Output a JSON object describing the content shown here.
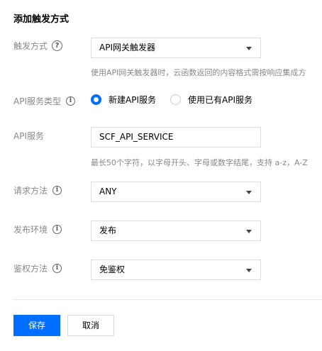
{
  "dialog": {
    "title": "添加触发方式"
  },
  "trigger": {
    "label": "触发方式",
    "value": "API网关触发器",
    "hint": "使用API网关触发器时，云函数返回的内容格式需按响应集成方"
  },
  "api_service_type": {
    "label": "API服务类型",
    "options": [
      "新建API服务",
      "使用已有API服务"
    ],
    "selected": "新建API服务"
  },
  "api_service": {
    "label": "API服务",
    "value": "SCF_API_SERVICE",
    "hint": "最长50个字符，以字母开头、字母或数字结尾，支持 a-z，A-Z"
  },
  "request_method": {
    "label": "请求方法",
    "value": "ANY"
  },
  "publish_env": {
    "label": "发布环境",
    "value": "发布"
  },
  "auth_method": {
    "label": "鉴权方法",
    "value": "免鉴权"
  },
  "buttons": {
    "save": "保存",
    "cancel": "取消"
  },
  "colors": {
    "primary": "#006eff",
    "label": "#888888",
    "border": "#dddddd"
  },
  "icons": {
    "help": "question-circle-icon",
    "info": "info-circle-icon",
    "caret": "caret-down-icon"
  }
}
